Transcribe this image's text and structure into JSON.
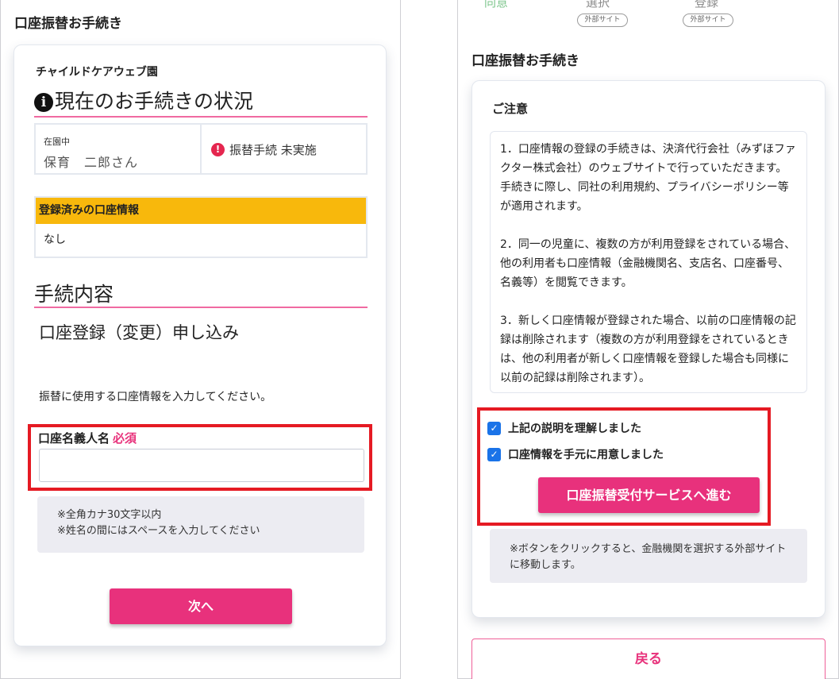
{
  "left": {
    "page_title": "口座振替お手続き",
    "school_name": "チャイルドケアウェブ園",
    "status_heading": "現在のお手続きの状況",
    "info_glyph": "i",
    "enrolled_label": "在園中",
    "child_name": "保育　二郎さん",
    "warn_glyph": "!",
    "transfer_status": "振替手続 未実施",
    "registered_header": "登録済みの口座情報",
    "registered_value": "なし",
    "procedure_heading": "手続内容",
    "procedure_name": "口座登録（変更）申し込み",
    "instruction": "振替に使用する口座情報を入力してください。",
    "account_holder_label": "口座名義人名",
    "required_label": "必須",
    "account_holder_value": "",
    "hints": [
      "※全角カナ30文字以内",
      "※姓名の間にはスペースを入力してください"
    ],
    "next_button": "次へ"
  },
  "right": {
    "steps": [
      {
        "label": "同意",
        "pill": ""
      },
      {
        "label": "選択",
        "pill": "外部サイト"
      },
      {
        "label": "登録",
        "pill": "外部サイト"
      }
    ],
    "page_title": "口座振替お手続き",
    "notice_title": "ご注意",
    "notices": [
      "1．口座情報の登録の手続きは、決済代行会社（みずほファクター株式会社）のウェブサイトで行っていただきます。手続きに際し、同社の利用規約、プライバシーポリシー等が適用されます。",
      "2．同一の児童に、複数の方が利用登録をされている場合、他の利用者も口座情報（金融機関名、支店名、口座番号、名義等）を閲覧できます。",
      "3．新しく口座情報が登録された場合、以前の口座情報の記録は削除されます（複数の方が利用登録をされているときは、他の利用者が新しく口座情報を登録した場合も同様に以前の記録は削除されます）。"
    ],
    "check1": "上記の説明を理解しました",
    "check2": "口座情報を手元に用意しました",
    "check_glyph": "✓",
    "proceed_button": "口座振替受付サービスへ進む",
    "proceed_note": "※ボタンをクリックすると、金融機関を選択する外部サイトに移動します。",
    "back_button": "戻る"
  },
  "colors": {
    "accent_pink": "#e8317c",
    "highlight_red": "#e51a23",
    "registered_header_bg": "#f8b80c",
    "checkbox_blue": "#1a73e8",
    "step_done_green": "#7cc58b"
  }
}
